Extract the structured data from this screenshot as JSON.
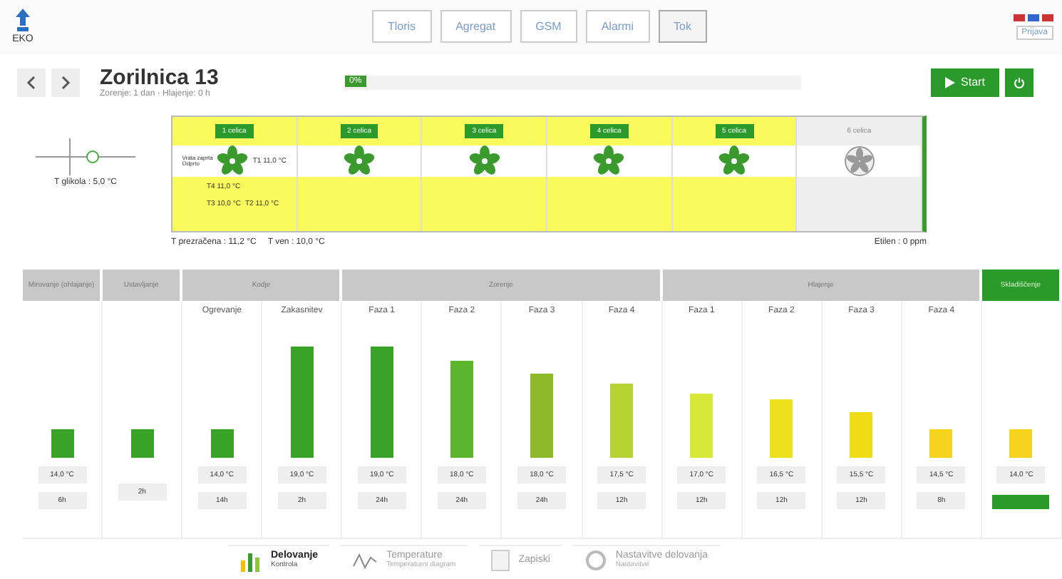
{
  "logo": {
    "text": "EKO"
  },
  "nav_tabs": [
    {
      "label": "Tloris",
      "selected": false
    },
    {
      "label": "Agregat",
      "selected": false
    },
    {
      "label": "GSM",
      "selected": false
    },
    {
      "label": "Alarmi",
      "selected": false
    },
    {
      "label": "Tok",
      "selected": true
    }
  ],
  "login": {
    "label": "Prijava"
  },
  "room": {
    "title": "Zorilnica 13",
    "subtitle": "Zorenje: 1 dan · Hlajenje: 0 h",
    "progress": {
      "label": "0%"
    }
  },
  "start_button": "Start",
  "diagram": {
    "glycol": "T glikola : 5,0 °C",
    "door": "Vrata zaprta",
    "door_state": "Odprto",
    "cells": [
      {
        "label": "1 celica",
        "kind": "active"
      },
      {
        "label": "2 celica",
        "kind": "active"
      },
      {
        "label": "3 celica",
        "kind": "active"
      },
      {
        "label": "4 celica",
        "kind": "active"
      },
      {
        "label": "5 celica",
        "kind": "active"
      },
      {
        "label": "6 celica",
        "kind": "idle"
      }
    ],
    "t1": "T1 11,0 °C",
    "t4": "T4 11,0 °C",
    "t3": "T3 10,0 °C",
    "t2": "T2 11,0 °C",
    "t_air": "T prezračena : 11,2 °C",
    "t_out": "T ven : 10,0 °C",
    "ethylene": "Etilen : 0 ppm"
  },
  "stages": [
    {
      "label": "Mirovanje (ohlajanje)",
      "selected": false
    },
    {
      "label": "Ustavljanje",
      "selected": false
    },
    {
      "label": "Kodje",
      "selected": false
    },
    {
      "label": "Zorenje",
      "selected": false
    },
    {
      "label": "Hlajenje",
      "selected": false
    },
    {
      "label": "Skladiščenje",
      "selected": true
    }
  ],
  "columns": [
    {
      "color": "#3aa229",
      "temp": "14,0 °C",
      "time": "6h"
    },
    {
      "color": "#3aa229",
      "time": "2h"
    },
    {
      "name": "Ogrevanje",
      "color": "#3aa229",
      "temp": "14,0 °C",
      "time": "14h"
    },
    {
      "name": "Zakasnitev",
      "color": "#3aa229",
      "temp": "19,0 °C",
      "time": "2h"
    },
    {
      "name": "Faza 1",
      "color": "#3aa229",
      "temp": "19,0 °C",
      "time": "24h"
    },
    {
      "name": "Faza 2",
      "color": "#5cb52e",
      "temp": "18,0 °C",
      "time": "24h"
    },
    {
      "name": "Faza 3",
      "color": "#8cb82a",
      "temp": "18,0 °C",
      "time": "24h"
    },
    {
      "name": "Faza 4",
      "color": "#b5d433",
      "temp": "17,5 °C",
      "time": "12h"
    },
    {
      "name": "Faza 1",
      "color": "#d8e838",
      "temp": "17,0 °C",
      "time": "12h"
    },
    {
      "name": "Faza 2",
      "color": "#ecdf1c",
      "temp": "16,5 °C",
      "time": "12h"
    },
    {
      "name": "Faza 3",
      "color": "#f0dc14",
      "temp": "15,5 °C",
      "time": "12h"
    },
    {
      "name": "Faza 4",
      "color": "#f5d21c",
      "temp": "14,5 °C",
      "time": "8h"
    },
    {
      "color": "#f5d21c",
      "temp": "14,0 °C"
    }
  ],
  "bottom_tabs": [
    {
      "title": "Delovanje",
      "subtitle": "Kontrola",
      "selected": true
    },
    {
      "title": "Temperature",
      "subtitle": "Temperaturni diagram",
      "selected": false
    },
    {
      "title": "Zapiski",
      "selected": false
    },
    {
      "title": "Nastavitve delovanja",
      "subtitle": "Nastavitve",
      "selected": false
    }
  ]
}
